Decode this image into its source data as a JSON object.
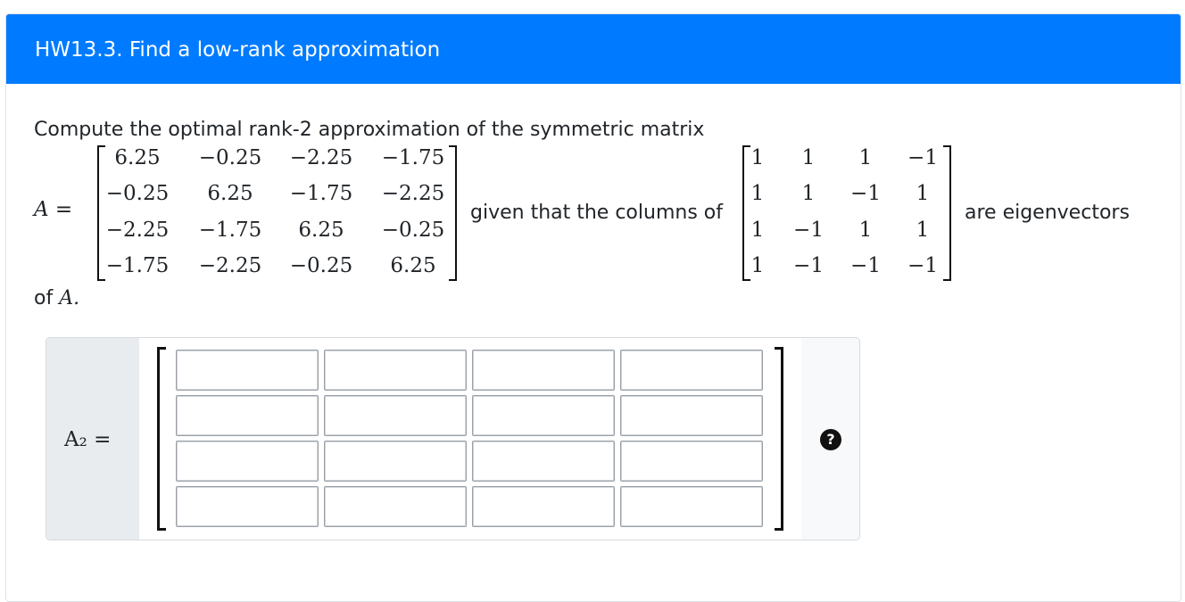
{
  "header": {
    "title": "HW13.3. Find a low-rank approximation"
  },
  "problem": {
    "intro": "Compute the optimal rank-2 approximation of the symmetric matrix",
    "matrix_label": "A =",
    "matrix_A": [
      [
        "6.25",
        "−0.25",
        "−2.25",
        "−1.75"
      ],
      [
        "−0.25",
        "6.25",
        "−1.75",
        "−2.25"
      ],
      [
        "−2.25",
        "−1.75",
        "6.25",
        "−0.25"
      ],
      [
        "−1.75",
        "−2.25",
        "−0.25",
        "6.25"
      ]
    ],
    "given_text": "given that the columns of",
    "eigen_matrix": [
      [
        "1",
        "1",
        "1",
        "−1"
      ],
      [
        "1",
        "1",
        "−1",
        "1"
      ],
      [
        "1",
        "−1",
        "1",
        "1"
      ],
      [
        "1",
        "−1",
        "−1",
        "−1"
      ]
    ],
    "are_text": "are eigenvectors",
    "of_text": "of",
    "of_var": "A."
  },
  "answer": {
    "label": "A₂ =",
    "help_icon": "?",
    "rows": 4,
    "cols": 4
  }
}
